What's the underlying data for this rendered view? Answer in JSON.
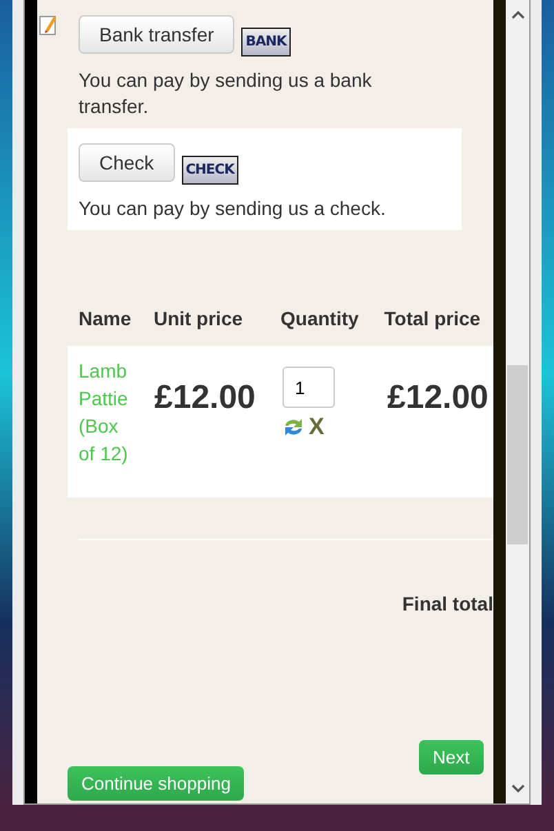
{
  "payment_methods": [
    {
      "button": "Bank transfer",
      "logo": "BANK",
      "description": "You can pay by sending us a bank transfer.",
      "selected": false
    },
    {
      "button": "Check",
      "logo": "CHECK",
      "description": "You can pay by sending us a check.",
      "selected": true
    }
  ],
  "cart": {
    "columns": [
      "Name",
      "Unit price",
      "Quantity",
      "Total price"
    ],
    "rows": [
      {
        "name": "Lamb Pattie (Box of 12)",
        "unit_price": "£12.00",
        "quantity": "1",
        "total_price": "£12.00",
        "remove": "X"
      }
    ],
    "final_total_label": "Final total"
  },
  "buttons": {
    "next": "Next",
    "continue": "Continue shopping"
  }
}
